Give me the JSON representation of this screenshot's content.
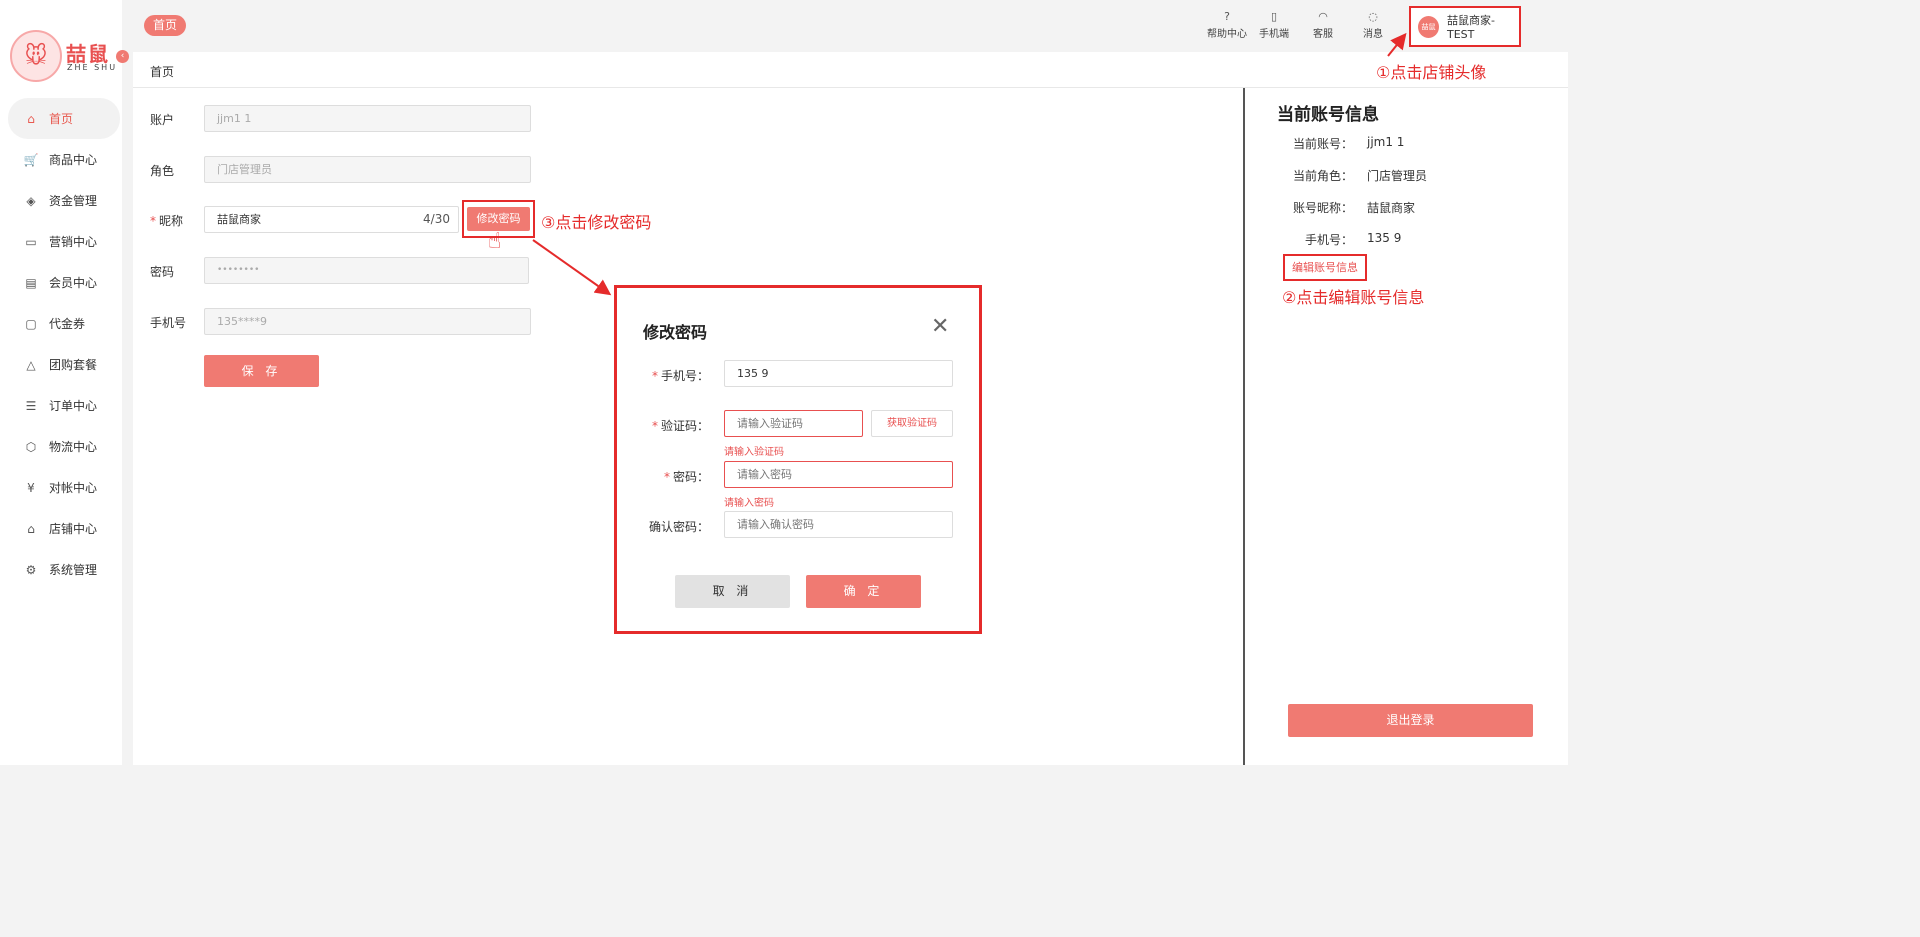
{
  "logo": {
    "cn": "喆鼠",
    "en": "ZHE SHU"
  },
  "nav": [
    {
      "label": "首页",
      "icon": "home-icon",
      "active": true
    },
    {
      "label": "商品中心",
      "icon": "cart-icon"
    },
    {
      "label": "资金管理",
      "icon": "layers-icon"
    },
    {
      "label": "营销中心",
      "icon": "megaphone-icon"
    },
    {
      "label": "会员中心",
      "icon": "vip-card-icon"
    },
    {
      "label": "代金券",
      "icon": "coupon-icon"
    },
    {
      "label": "团购套餐",
      "icon": "bag-icon"
    },
    {
      "label": "订单中心",
      "icon": "order-icon"
    },
    {
      "label": "物流中心",
      "icon": "box-icon"
    },
    {
      "label": "对帐中心",
      "icon": "yen-icon"
    },
    {
      "label": "店铺中心",
      "icon": "store-icon"
    },
    {
      "label": "系统管理",
      "icon": "settings-icon"
    }
  ],
  "header": {
    "home_tag": "首页",
    "tools": [
      {
        "label": "帮助中心",
        "icon": "help-icon",
        "glyph": "?"
      },
      {
        "label": "手机端",
        "icon": "phone-icon",
        "glyph": "▯"
      },
      {
        "label": "客服",
        "icon": "headset-icon",
        "glyph": "◠"
      },
      {
        "label": "消息",
        "icon": "message-icon",
        "glyph": "◌"
      }
    ],
    "shop_name": "喆鼠商家-TEST",
    "shop_avatar": "喆鼠"
  },
  "breadcrumb": "首页",
  "form": {
    "account_label": "账户",
    "account_value": "jjm1 1",
    "role_label": "角色",
    "role_value": "门店管理员",
    "nickname_label": "昵称",
    "nickname_value": "喆鼠商家",
    "nickname_count": "4/30",
    "change_pw_label": "修改密码",
    "password_label": "密码",
    "password_value": "••••••••",
    "phone_label": "手机号",
    "phone_value": "135****9",
    "save_label": "保 存"
  },
  "annotations": {
    "step1": "①点击店铺头像",
    "step2": "②点击编辑账号信息",
    "step3": "③点击修改密码"
  },
  "right_panel": {
    "title": "当前账号信息",
    "rows": [
      {
        "label": "当前账号：",
        "value": "jjm1 1"
      },
      {
        "label": "当前角色：",
        "value": "门店管理员"
      },
      {
        "label": "账号昵称：",
        "value": "喆鼠商家"
      },
      {
        "label": "手机号：",
        "value": "135 9"
      }
    ],
    "edit_label": "编辑账号信息",
    "logout_label": "退出登录"
  },
  "modal": {
    "title": "修改密码",
    "phone_label": "手机号：",
    "phone_value": "135 9",
    "code_label": "验证码：",
    "code_placeholder": "请输入验证码",
    "code_button": "获取验证码",
    "code_error": "请输入验证码",
    "pw_label": "密码：",
    "pw_placeholder": "请输入密码",
    "pw_error": "请输入密码",
    "confirm_label": "确认密码：",
    "confirm_placeholder": "请输入确认密码",
    "cancel_label": "取 消",
    "ok_label": "确 定"
  }
}
